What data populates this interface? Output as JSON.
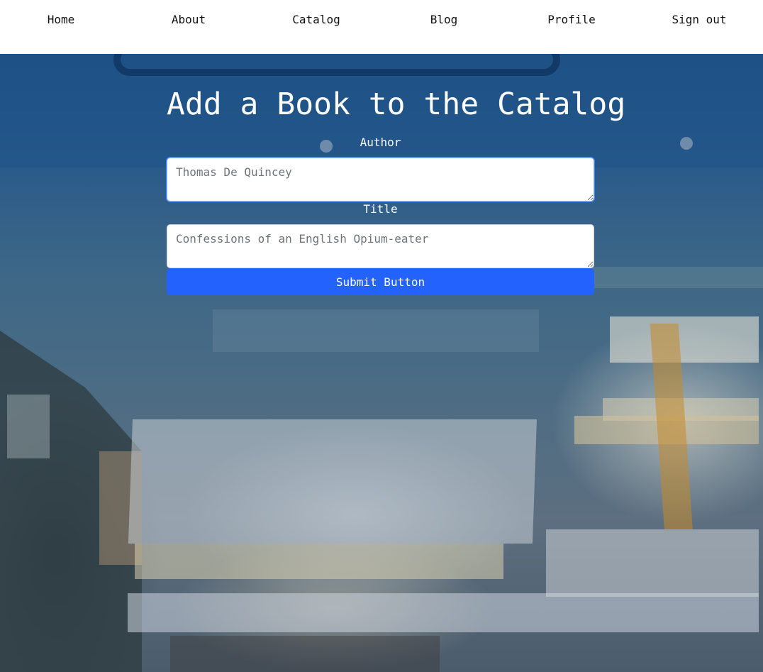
{
  "nav": {
    "items": [
      {
        "label": "Home"
      },
      {
        "label": "About"
      },
      {
        "label": "Catalog"
      },
      {
        "label": "Blog"
      },
      {
        "label": "Profile"
      },
      {
        "label": "Sign out"
      }
    ]
  },
  "form": {
    "title": "Add a Book to the Catalog",
    "author": {
      "label": "Author",
      "value": "",
      "placeholder": "Thomas De Quincey"
    },
    "title_field": {
      "label": "Title",
      "value": "",
      "placeholder": "Confessions of an English Opium-eater"
    },
    "submit_label": "Submit Button"
  },
  "colors": {
    "accent": "#2462fd",
    "nav_background": "#ffffff",
    "text_on_hero": "#ffffff"
  }
}
